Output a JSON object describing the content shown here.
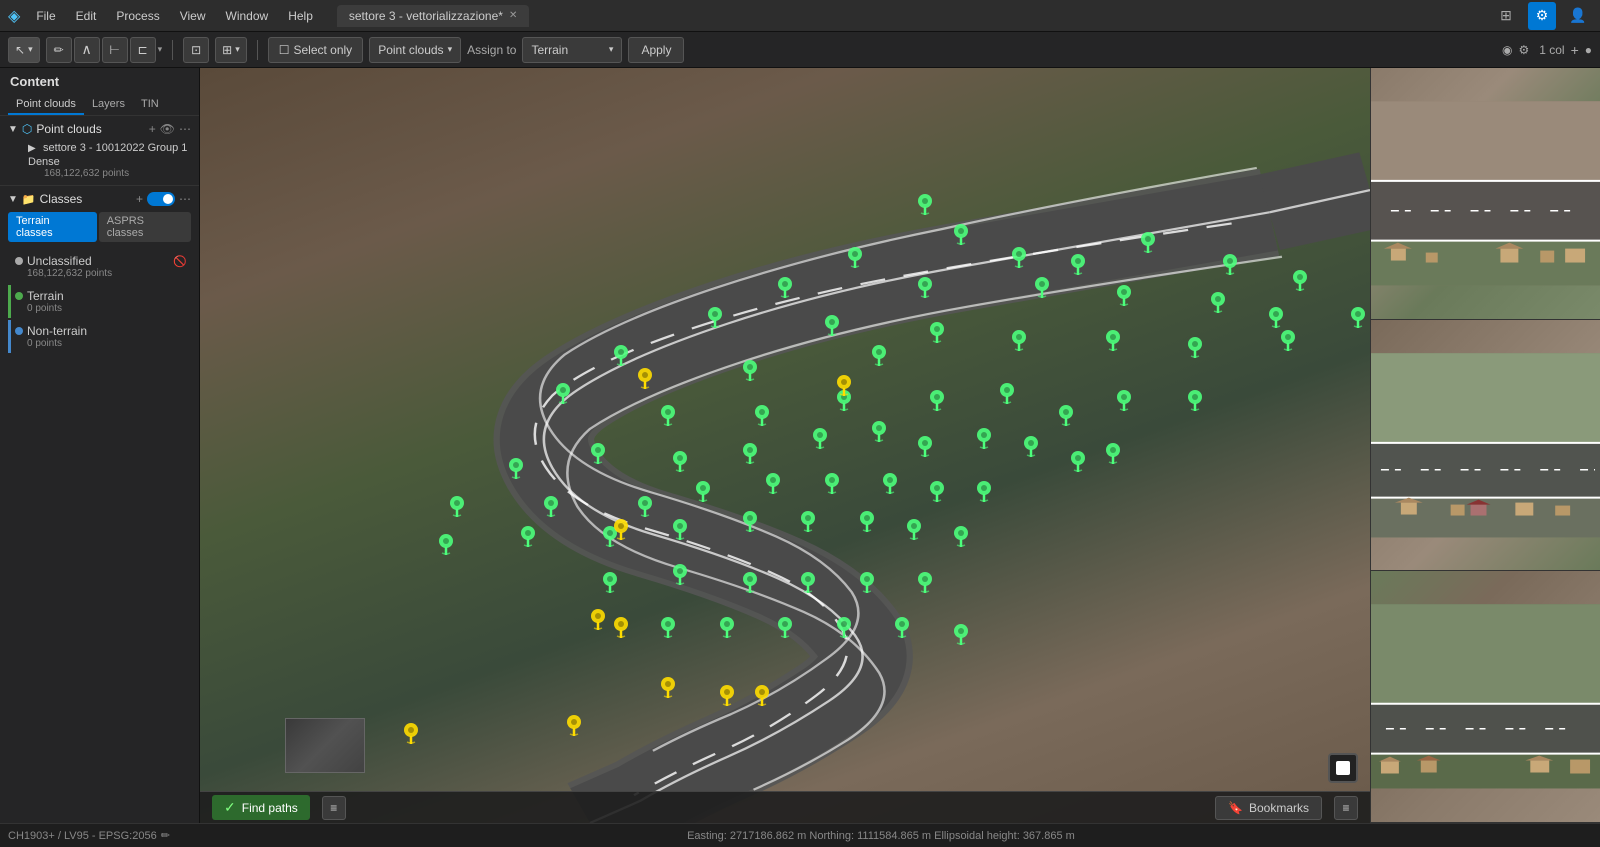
{
  "titlebar": {
    "app_icon": "◈",
    "menus": [
      "File",
      "Edit",
      "Process",
      "View",
      "Window",
      "Help"
    ],
    "tab_label": "settore 3 - vettorializzazione*",
    "right_icons": [
      "grid-icon",
      "gear-icon",
      "user-icon"
    ]
  },
  "toolbar": {
    "tools": [
      {
        "id": "select",
        "label": "↖",
        "active": true
      },
      {
        "id": "draw-line",
        "label": "✏"
      },
      {
        "id": "polygon",
        "label": "⬡"
      },
      {
        "id": "ruler",
        "label": "⊢"
      },
      {
        "id": "bracket",
        "label": "⊏"
      }
    ],
    "select_only_label": "Select only",
    "point_clouds_label": "Point clouds",
    "assign_label": "Assign to",
    "terrain_label": "Terrain",
    "apply_label": "Apply",
    "right_controls": {
      "filter_icon": "⚙",
      "col_label": "1 col",
      "plus_label": "+",
      "dot_label": "●"
    }
  },
  "sidebar": {
    "content_label": "Content",
    "tabs": [
      "Point clouds",
      "Layers",
      "TIN"
    ],
    "point_clouds_section": {
      "title": "Point clouds",
      "cloud_name": "settore 3 - 10012022 Group 1 Dense",
      "cloud_count": "168,122,632 points"
    },
    "classes_section": {
      "title": "Classes",
      "toggle": true,
      "class_tabs": [
        "Terrain classes",
        "ASPRS classes"
      ],
      "active_tab": "Terrain classes",
      "items": [
        {
          "name": "Unclassified",
          "color": "#aaaaaa",
          "points": "168,122,632 points",
          "hidden": true
        },
        {
          "name": "Terrain",
          "color": "#4daa4d",
          "points": "0 points",
          "hidden": false
        },
        {
          "name": "Non-terrain",
          "color": "#4488cc",
          "points": "0 points",
          "hidden": false
        }
      ]
    }
  },
  "map": {
    "find_paths_label": "Find paths",
    "bookmarks_label": "Bookmarks"
  },
  "statusbar": {
    "crs_label": "CH1903+ / LV95 - EPSG:2056",
    "edit_icon": "✏",
    "coordinates": "Easting: 2717186.862 m  Northing: 1111584.865 m  Ellipsoidal height: 367.865 m"
  },
  "pins": {
    "green_positions": [
      [
        0.62,
        0.2
      ],
      [
        0.65,
        0.24
      ],
      [
        0.56,
        0.27
      ],
      [
        0.7,
        0.27
      ],
      [
        0.75,
        0.28
      ],
      [
        0.81,
        0.25
      ],
      [
        0.88,
        0.28
      ],
      [
        0.94,
        0.3
      ],
      [
        0.5,
        0.31
      ],
      [
        0.62,
        0.31
      ],
      [
        0.72,
        0.31
      ],
      [
        0.79,
        0.32
      ],
      [
        0.87,
        0.33
      ],
      [
        0.92,
        0.35
      ],
      [
        0.99,
        0.35
      ],
      [
        0.44,
        0.35
      ],
      [
        0.54,
        0.36
      ],
      [
        0.63,
        0.37
      ],
      [
        0.58,
        0.4
      ],
      [
        0.7,
        0.38
      ],
      [
        0.78,
        0.38
      ],
      [
        0.85,
        0.39
      ],
      [
        0.93,
        0.38
      ],
      [
        0.36,
        0.4
      ],
      [
        0.47,
        0.42
      ],
      [
        0.31,
        0.45
      ],
      [
        0.4,
        0.48
      ],
      [
        0.48,
        0.48
      ],
      [
        0.55,
        0.46
      ],
      [
        0.63,
        0.46
      ],
      [
        0.69,
        0.45
      ],
      [
        0.74,
        0.48
      ],
      [
        0.79,
        0.46
      ],
      [
        0.85,
        0.46
      ],
      [
        0.27,
        0.55
      ],
      [
        0.34,
        0.53
      ],
      [
        0.41,
        0.54
      ],
      [
        0.47,
        0.53
      ],
      [
        0.53,
        0.51
      ],
      [
        0.58,
        0.5
      ],
      [
        0.62,
        0.52
      ],
      [
        0.67,
        0.51
      ],
      [
        0.71,
        0.52
      ],
      [
        0.75,
        0.54
      ],
      [
        0.78,
        0.53
      ],
      [
        0.22,
        0.6
      ],
      [
        0.3,
        0.6
      ],
      [
        0.38,
        0.6
      ],
      [
        0.43,
        0.58
      ],
      [
        0.49,
        0.57
      ],
      [
        0.54,
        0.57
      ],
      [
        0.59,
        0.57
      ],
      [
        0.63,
        0.58
      ],
      [
        0.67,
        0.58
      ],
      [
        0.21,
        0.65
      ],
      [
        0.28,
        0.64
      ],
      [
        0.35,
        0.64
      ],
      [
        0.41,
        0.63
      ],
      [
        0.47,
        0.62
      ],
      [
        0.52,
        0.62
      ],
      [
        0.57,
        0.62
      ],
      [
        0.61,
        0.63
      ],
      [
        0.65,
        0.64
      ],
      [
        0.35,
        0.7
      ],
      [
        0.41,
        0.69
      ],
      [
        0.47,
        0.7
      ],
      [
        0.52,
        0.7
      ],
      [
        0.57,
        0.7
      ],
      [
        0.62,
        0.7
      ],
      [
        0.4,
        0.76
      ],
      [
        0.45,
        0.76
      ],
      [
        0.5,
        0.76
      ],
      [
        0.55,
        0.76
      ],
      [
        0.6,
        0.76
      ],
      [
        0.65,
        0.77
      ]
    ],
    "yellow_positions": [
      [
        0.38,
        0.43
      ],
      [
        0.55,
        0.44
      ],
      [
        0.36,
        0.63
      ],
      [
        0.34,
        0.75
      ],
      [
        0.36,
        0.76
      ],
      [
        0.4,
        0.84
      ],
      [
        0.45,
        0.85
      ],
      [
        0.48,
        0.85
      ],
      [
        0.32,
        0.89
      ],
      [
        0.18,
        0.9
      ]
    ]
  }
}
